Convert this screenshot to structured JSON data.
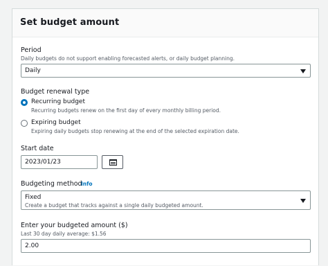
{
  "panel": {
    "title": "Set budget amount"
  },
  "period": {
    "label": "Period",
    "description": "Daily budgets do not support enabling forecasted alerts, or daily budget planning.",
    "selected": "Daily"
  },
  "renewal": {
    "label": "Budget renewal type",
    "options": [
      {
        "label": "Recurring budget",
        "description": "Recurring budgets renew on the first day of every monthly billing period.",
        "checked": true
      },
      {
        "label": "Expiring budget",
        "description": "Expiring daily budgets stop renewing at the end of the selected expiration date.",
        "checked": false
      }
    ]
  },
  "start_date": {
    "label": "Start date",
    "value": "2023/01/23",
    "icon": "calendar-icon"
  },
  "method": {
    "label": "Budgeting method",
    "info": "Info",
    "selected": "Fixed",
    "selected_description": "Create a budget that tracks against a single daily budgeted amount."
  },
  "amount": {
    "label": "Enter your budgeted amount ($)",
    "hint": "Last 30 day daily average: $1.56",
    "value": "2.00"
  },
  "colors": {
    "accent": "#0073bb",
    "border": "#879596",
    "muted_text": "#545b64"
  }
}
